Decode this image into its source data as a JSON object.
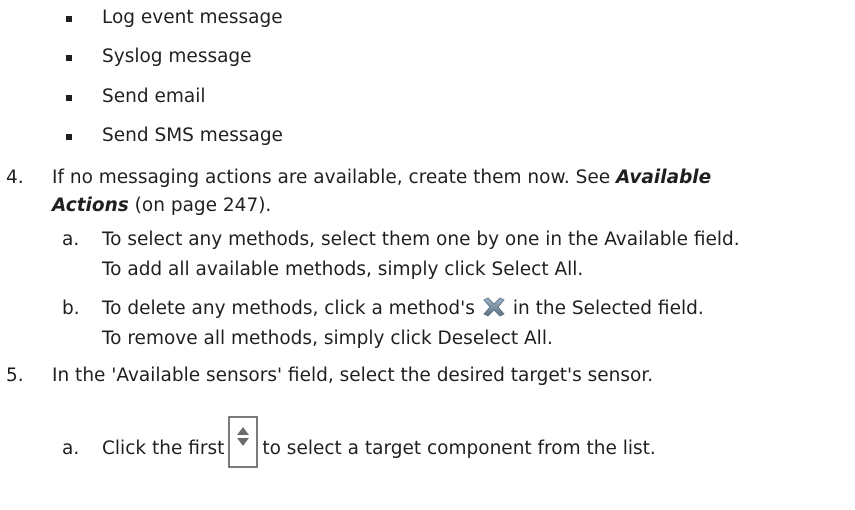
{
  "bullets": [
    "Log event message",
    "Syslog message",
    "Send email",
    "Send SMS message"
  ],
  "step4": {
    "number": "4.",
    "text_a": "If no messaging actions are available, create them now. See ",
    "link_part1": "Available",
    "link_part2": "Actions",
    "text_b": " (on page 247).",
    "sub_a": {
      "letter": "a.",
      "line1": "To select any methods, select them one by one in the Available field.",
      "line2": "To add all available methods, simply click Select All."
    },
    "sub_b": {
      "letter": "b.",
      "text_before_icon": "To delete any methods, click a method's",
      "icon": "delete-x-icon",
      "text_after_icon": "in the Selected field.",
      "line2": "To remove all methods, simply click Deselect All."
    }
  },
  "step5": {
    "number": "5.",
    "text": "In the 'Available sensors' field, select the desired target's sensor.",
    "sub_a": {
      "letter": "a.",
      "text_before_icon": "Click the first",
      "icon": "spinner-updown-icon",
      "text_after_icon": "to select a target component from the list."
    }
  }
}
